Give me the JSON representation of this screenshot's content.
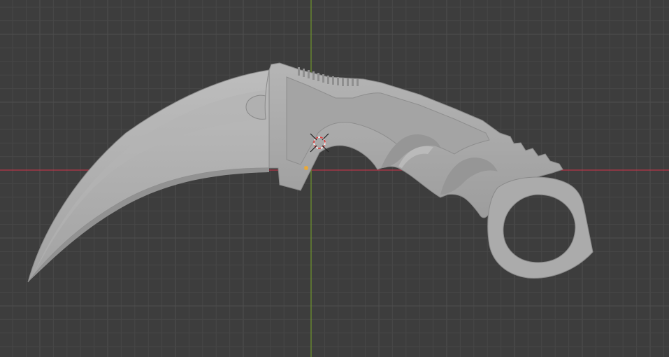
{
  "viewport": {
    "view": "front-orthographic",
    "colors": {
      "background": "#3d3d3d",
      "grid_minor": "#474747",
      "grid_major": "#4f4f4f",
      "x_axis": "#b8364a",
      "z_axis": "#6c8f2d",
      "mesh": "#a9a9a9",
      "mesh_light": "#b9b9b9",
      "mesh_shadow": "#8e8e8e",
      "mesh_outline": "#7a7a7a",
      "cursor_red": "#e03c3c",
      "cursor_white": "#ffffff",
      "origin": "#e8a93a"
    },
    "objects": [
      {
        "name": "karambit-knife-mesh",
        "type": "mesh",
        "selected": false
      }
    ],
    "icons": [
      "3d-cursor-icon",
      "origin-dot-icon"
    ]
  }
}
